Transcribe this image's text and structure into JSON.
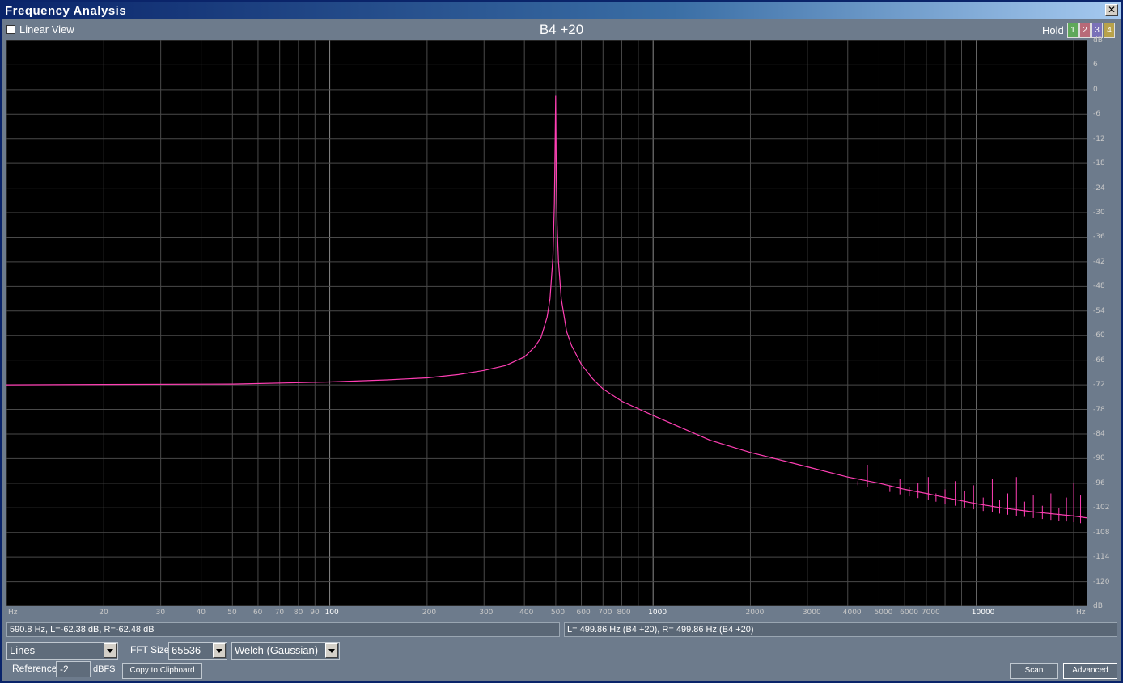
{
  "window": {
    "title": "Frequency Analysis",
    "close_icon": "close-icon",
    "close_label": "✕"
  },
  "toolbar": {
    "linear_view_label": "Linear View",
    "linear_view_checked": false,
    "note": "B4 +20",
    "hold_label": "Hold",
    "hold_buttons": [
      {
        "label": "1",
        "color": "#5fa85a"
      },
      {
        "label": "2",
        "color": "#b86a78"
      },
      {
        "label": "3",
        "color": "#7a72b8"
      },
      {
        "label": "4",
        "color": "#b8a24a"
      }
    ]
  },
  "chart_data": {
    "type": "line",
    "x_scale": "log",
    "xlim": [
      10,
      22050
    ],
    "ylim": [
      -126,
      12
    ],
    "x_unit": "Hz",
    "y_unit": "dB",
    "x_ticks": [
      {
        "v": 10,
        "label": "Hz"
      },
      {
        "v": 20,
        "label": "20"
      },
      {
        "v": 30,
        "label": "30"
      },
      {
        "v": 40,
        "label": "40"
      },
      {
        "v": 50,
        "label": "50"
      },
      {
        "v": 60,
        "label": "60"
      },
      {
        "v": 70,
        "label": "70"
      },
      {
        "v": 80,
        "label": "80"
      },
      {
        "v": 90,
        "label": "90"
      },
      {
        "v": 100,
        "label": "100"
      },
      {
        "v": 200,
        "label": "200"
      },
      {
        "v": 300,
        "label": "300"
      },
      {
        "v": 400,
        "label": "400"
      },
      {
        "v": 500,
        "label": "500"
      },
      {
        "v": 600,
        "label": "600"
      },
      {
        "v": 700,
        "label": "700"
      },
      {
        "v": 800,
        "label": "800"
      },
      {
        "v": 1000,
        "label": "1000"
      },
      {
        "v": 2000,
        "label": "2000"
      },
      {
        "v": 3000,
        "label": "3000"
      },
      {
        "v": 4000,
        "label": "4000"
      },
      {
        "v": 5000,
        "label": "5000"
      },
      {
        "v": 6000,
        "label": "6000"
      },
      {
        "v": 7000,
        "label": "7000"
      },
      {
        "v": 10000,
        "label": "10000"
      },
      {
        "v": 22050,
        "label": "Hz"
      }
    ],
    "y_ticks": [
      {
        "v": 12,
        "label": "dB"
      },
      {
        "v": 6,
        "label": "6"
      },
      {
        "v": 0,
        "label": "0"
      },
      {
        "v": -6,
        "label": "-6"
      },
      {
        "v": -12,
        "label": "-12"
      },
      {
        "v": -18,
        "label": "-18"
      },
      {
        "v": -24,
        "label": "-24"
      },
      {
        "v": -30,
        "label": "-30"
      },
      {
        "v": -36,
        "label": "-36"
      },
      {
        "v": -42,
        "label": "-42"
      },
      {
        "v": -48,
        "label": "-48"
      },
      {
        "v": -54,
        "label": "-54"
      },
      {
        "v": -60,
        "label": "-60"
      },
      {
        "v": -66,
        "label": "-66"
      },
      {
        "v": -72,
        "label": "-72"
      },
      {
        "v": -78,
        "label": "-78"
      },
      {
        "v": -84,
        "label": "-84"
      },
      {
        "v": -90,
        "label": "-90"
      },
      {
        "v": -96,
        "label": "-96"
      },
      {
        "v": -102,
        "label": "-102"
      },
      {
        "v": -108,
        "label": "-108"
      },
      {
        "v": -114,
        "label": "-114"
      },
      {
        "v": -120,
        "label": "-120"
      },
      {
        "v": -126,
        "label": "dB"
      }
    ],
    "series": [
      {
        "color": "#ff3fb4",
        "x": [
          10,
          20,
          50,
          100,
          150,
          200,
          250,
          300,
          350,
          400,
          430,
          450,
          470,
          480,
          490,
          495,
          498,
          499.86,
          502,
          505,
          510,
          520,
          540,
          560,
          600,
          650,
          700,
          800,
          1000,
          1500,
          2000,
          3000,
          4000,
          5000,
          6000,
          7000,
          8000,
          10000,
          12000,
          15000,
          20000,
          22050
        ],
        "y": [
          -72.0,
          -71.9,
          -71.8,
          -71.3,
          -70.8,
          -70.3,
          -69.5,
          -68.5,
          -67.3,
          -65.2,
          -62.8,
          -60.5,
          -55.5,
          -51.0,
          -41.0,
          -28.0,
          -12.0,
          -1.5,
          -22.0,
          -33.0,
          -42.0,
          -51.0,
          -59.0,
          -62.5,
          -67.0,
          -70.5,
          -73.0,
          -76.0,
          -79.5,
          -85.5,
          -88.5,
          -92.0,
          -94.5,
          -96.0,
          -97.5,
          -98.5,
          -99.5,
          -101.0,
          -102.0,
          -103.0,
          -104.0,
          -104.5
        ]
      }
    ],
    "noise_spikes": [
      {
        "x": 4300,
        "y": -95.5
      },
      {
        "x": 4600,
        "y": -91.5
      },
      {
        "x": 5000,
        "y": -96.0
      },
      {
        "x": 5400,
        "y": -96.5
      },
      {
        "x": 5800,
        "y": -95.0
      },
      {
        "x": 6200,
        "y": -97.0
      },
      {
        "x": 6600,
        "y": -96.0
      },
      {
        "x": 7100,
        "y": -94.5
      },
      {
        "x": 7500,
        "y": -98.5
      },
      {
        "x": 8000,
        "y": -97.5
      },
      {
        "x": 8600,
        "y": -95.5
      },
      {
        "x": 9200,
        "y": -98.0
      },
      {
        "x": 9800,
        "y": -96.5
      },
      {
        "x": 10500,
        "y": -99.5
      },
      {
        "x": 11200,
        "y": -95.0
      },
      {
        "x": 11800,
        "y": -100.0
      },
      {
        "x": 12500,
        "y": -98.5
      },
      {
        "x": 13300,
        "y": -94.5
      },
      {
        "x": 14100,
        "y": -100.5
      },
      {
        "x": 15000,
        "y": -99.0
      },
      {
        "x": 16000,
        "y": -101.5
      },
      {
        "x": 17000,
        "y": -98.5
      },
      {
        "x": 18000,
        "y": -102.0
      },
      {
        "x": 19000,
        "y": -99.5
      },
      {
        "x": 20000,
        "y": -96.0
      },
      {
        "x": 21000,
        "y": -99.0
      }
    ]
  },
  "status": {
    "cursor": "590.8 Hz, L=-62.38 dB, R=-62.48 dB",
    "peak": "L= 499.86 Hz (B4 +20), R= 499.86 Hz (B4 +20)"
  },
  "controls": {
    "display_mode": "Lines",
    "fft_size_label": "FFT Size",
    "fft_size": "65536",
    "window_fn": "Welch (Gaussian)",
    "reference_label": "Reference",
    "reference_value": "-2",
    "reference_unit": "dBFS",
    "copy_label": "Copy to Clipboard",
    "scan_label": "Scan",
    "advanced_label": "Advanced"
  }
}
